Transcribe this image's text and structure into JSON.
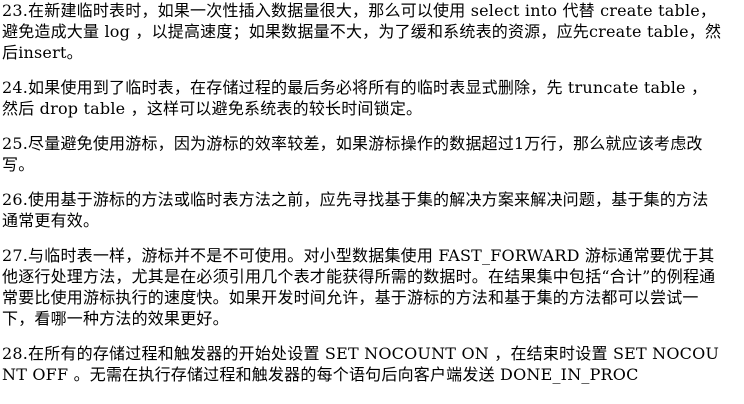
{
  "paragraphs": [
    "23.在新建临时表时，如果一次性插入数据量很大，那么可以使用 select into 代替 create table，避免造成大量 log ，以提高速度；如果数据量不大，为了缓和系统表的资源，应先create table，然后insert。",
    "24.如果使用到了临时表，在存储过程的最后务必将所有的临时表显式删除，先 truncate table ，然后 drop table ，这样可以避免系统表的较长时间锁定。",
    "25.尽量避免使用游标，因为游标的效率较差，如果游标操作的数据超过1万行，那么就应该考虑改写。",
    "26.使用基于游标的方法或临时表方法之前，应先寻找基于集的解决方案来解决问题，基于集的方法通常更有效。",
    "27.与临时表一样，游标并不是不可使用。对小型数据集使用 FAST_FORWARD 游标通常要优于其他逐行处理方法，尤其是在必须引用几个表才能获得所需的数据时。在结果集中包括“合计”的例程通常要比使用游标执行的速度快。如果开发时间允许，基于游标的方法和基于集的方法都可以尝试一下，看哪一种方法的效果更好。",
    "28.在所有的存储过程和触发器的开始处设置 SET NOCOUNT ON ，在结束时设置 SET NOCOUNT OFF 。无需在执行存储过程和触发器的每个语句后向客户端发送 DONE_IN_PROC"
  ]
}
